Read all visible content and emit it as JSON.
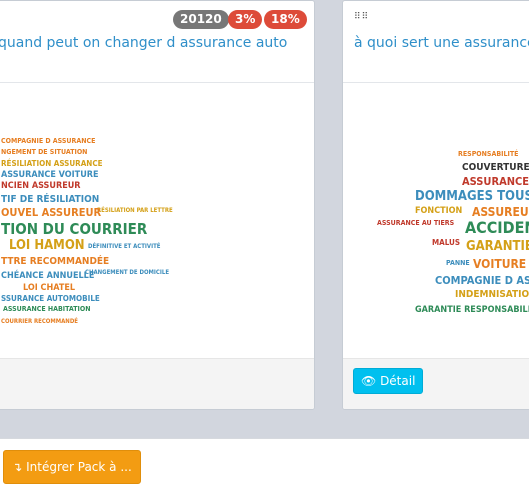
{
  "cards": [
    {
      "title": "quand peut on changer d assurance auto",
      "badges": [
        "20120",
        "3%",
        "18%"
      ],
      "badge_colors": [
        "#777777",
        "#dd4b39",
        "#dd4b39"
      ],
      "cloud_words": [
        {
          "t": "COMPAGNIE D ASSURANCE",
          "c": "#e67e22"
        },
        {
          "t": "NGEMENT DE SITUATION",
          "c": "#e67e22"
        },
        {
          "t": "RÉSILIATION ASSURANCE",
          "c": "#d4a017"
        },
        {
          "t": "ASSURANCE VOITURE",
          "c": "#3c8dbc"
        },
        {
          "t": "NCIEN ASSUREUR",
          "c": "#c0392b"
        },
        {
          "t": "TIF DE RÉSILIATION",
          "c": "#3c8dbc"
        },
        {
          "t": "RÉSILIATION PAR LETTRE",
          "c": "#d4a017"
        },
        {
          "t": "OUVEL ASSUREUR",
          "c": "#e67e22"
        },
        {
          "t": "TION DU COURRIER",
          "c": "#2e8b57"
        },
        {
          "t": "LOI HAMON",
          "c": "#d4a017"
        },
        {
          "t": "DÉFINITIVE ET ACTIVITÉ",
          "c": "#3c8dbc"
        },
        {
          "t": "TTRE RECOMMANDÉE",
          "c": "#e67e22"
        },
        {
          "t": "CHÉANCE ANNUELLE",
          "c": "#3c8dbc"
        },
        {
          "t": "CHANGEMENT DE DOMICILE",
          "c": "#3c8dbc"
        },
        {
          "t": "LOI CHATEL",
          "c": "#e67e22"
        },
        {
          "t": "SSURANCE AUTOMOBILE",
          "c": "#3c8dbc"
        },
        {
          "t": "ASSURANCE HABITATION",
          "c": "#2e8b57"
        },
        {
          "t": "COURRIER RECOMMANDÉ",
          "c": "#e67e22"
        }
      ]
    },
    {
      "title": "à quoi sert une assurance",
      "detail_label": "Détail",
      "cloud_words": [
        {
          "t": "RESPONSABILITÉ",
          "c": "#e67e22"
        },
        {
          "t": "COUVERTURE",
          "c": "#333333"
        },
        {
          "t": "ASSURANCES",
          "c": "#c0392b"
        },
        {
          "t": "DOMMAGES TOUS AC",
          "c": "#3c8dbc"
        },
        {
          "t": "FONCTION",
          "c": "#d4a017"
        },
        {
          "t": "ASSUREUR",
          "c": "#e67e22"
        },
        {
          "t": "ASSURANCE AU TIERS",
          "c": "#c0392b"
        },
        {
          "t": "ACCIDEN",
          "c": "#2e8b57"
        },
        {
          "t": "MALUS",
          "c": "#c0392b"
        },
        {
          "t": "GARANTIE",
          "c": "#d4a017"
        },
        {
          "t": "PANNE",
          "c": "#3c8dbc"
        },
        {
          "t": "VOITURE",
          "c": "#e67e22"
        },
        {
          "t": "COMPAGNIE D AS",
          "c": "#3c8dbc"
        },
        {
          "t": "INDEMNISATIO",
          "c": "#d4a017"
        },
        {
          "t": "GARANTIE RESPONSABILIT",
          "c": "#2e8b57"
        }
      ]
    }
  ],
  "actions": {
    "detail_icon": "eye-icon",
    "pack_button": "Intégrer Pack à ...",
    "pack_icon": "arrow-down-icon"
  }
}
